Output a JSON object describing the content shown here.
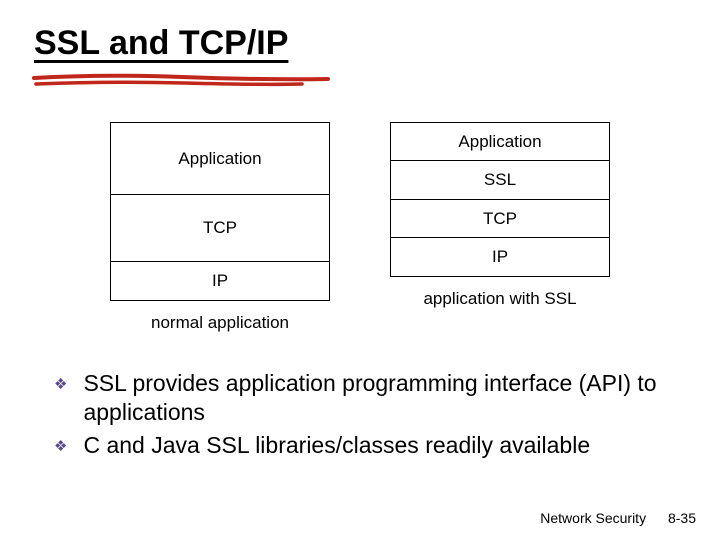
{
  "title": "SSL and TCP/IP",
  "left_stack": {
    "app": "Application",
    "tcp": "TCP",
    "ip": "IP",
    "caption": "normal application"
  },
  "right_stack": {
    "app": "Application",
    "ssl": "SSL",
    "tcp": "TCP",
    "ip": "IP",
    "caption": "application  with SSL"
  },
  "bullets": [
    " SSL provides application programming interface (API) to applications",
    " C and Java SSL libraries/classes readily available"
  ],
  "footer": {
    "section": "Network Security",
    "page": "8-35"
  }
}
